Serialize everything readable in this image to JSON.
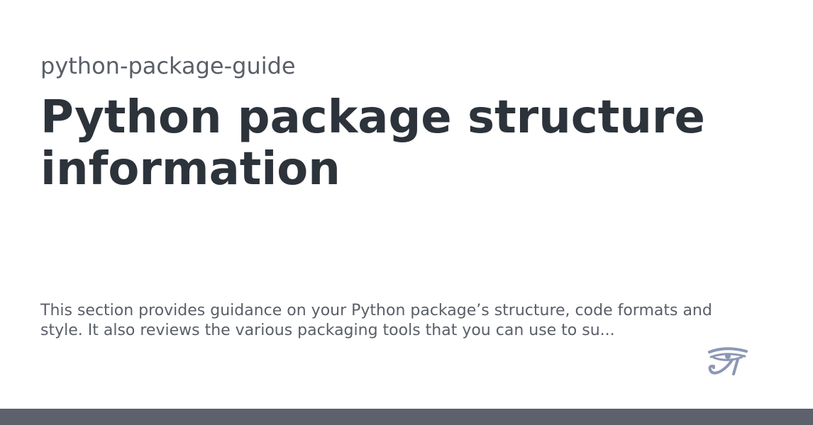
{
  "site": {
    "name": "python-package-guide"
  },
  "page": {
    "title": "Python package structure information",
    "description": "This section provides guidance on your Python package’s structure, code formats and style. It also reviews the various packaging tools that you can use to su..."
  },
  "logo": {
    "icon": "eye-of-horus-icon",
    "color": "#8c97b4"
  },
  "footer": {
    "color": "#5c616c"
  }
}
